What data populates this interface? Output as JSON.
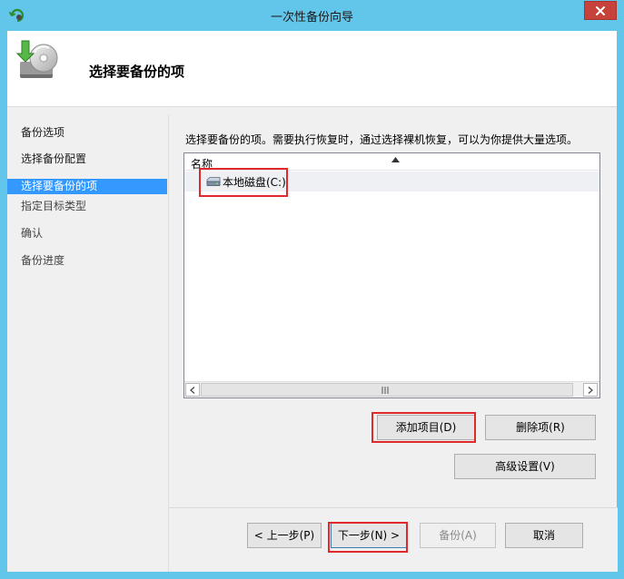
{
  "window": {
    "title": "一次性备份向导",
    "close_glyph": "✕"
  },
  "header": {
    "title": "选择要备份的项"
  },
  "nav": {
    "items": [
      {
        "label": "备份选项",
        "state": "done"
      },
      {
        "label": "选择备份配置",
        "state": "done"
      },
      {
        "label": "选择要备份的项",
        "state": "active"
      },
      {
        "label": "指定目标类型",
        "state": "pending"
      },
      {
        "label": "确认",
        "state": "pending"
      },
      {
        "label": "备份进度",
        "state": "pending"
      }
    ]
  },
  "content": {
    "description": "选择要备份的项。需要执行恢复时，通过选择裸机恢复，可以为你提供大量选项。",
    "list": {
      "column_header": "名称",
      "items": [
        {
          "label": "本地磁盘(C:)",
          "icon": "drive-icon"
        }
      ]
    },
    "buttons": {
      "add_items": "添加项目(D)",
      "remove_item": "删除项(R)",
      "advanced_settings": "高级设置(V)"
    }
  },
  "footer": {
    "back": "< 上一步(P)",
    "next": "下一步(N) >",
    "backup": "备份(A)",
    "cancel": "取消"
  },
  "colors": {
    "title_bar": "#62c6ea",
    "close_button": "#c7423a",
    "nav_active": "#3399ff",
    "highlight_box": "#e1282a"
  }
}
